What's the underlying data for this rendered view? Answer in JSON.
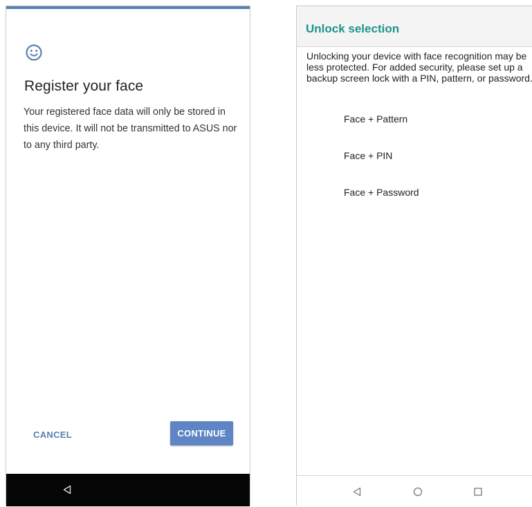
{
  "left": {
    "title": "Register your face",
    "body": "Your registered face data will only be stored in this device. It will not be transmitted to ASUS nor to any third party.",
    "cancel_label": "CANCEL",
    "continue_label": "CONTINUE",
    "icons": {
      "header": "smiley-face-icon",
      "nav_back": "back-triangle-icon"
    },
    "colors": {
      "accent": "#5f85c4",
      "top_line": "#5a7fb3",
      "navbar": "#050505"
    }
  },
  "right": {
    "title": "Unlock selection",
    "description": "Unlocking your device with face recognition may be less protected. For added security, please set up a backup screen lock with a PIN, pattern, or password.",
    "options": [
      {
        "label": "Face + Pattern"
      },
      {
        "label": "Face + PIN"
      },
      {
        "label": "Face + Password"
      }
    ],
    "icons": {
      "nav_back": "back-triangle-icon",
      "nav_home": "home-circle-icon",
      "nav_recents": "recents-square-icon"
    },
    "colors": {
      "title": "#1d9488",
      "header_bg": "#f4f4f4"
    }
  }
}
